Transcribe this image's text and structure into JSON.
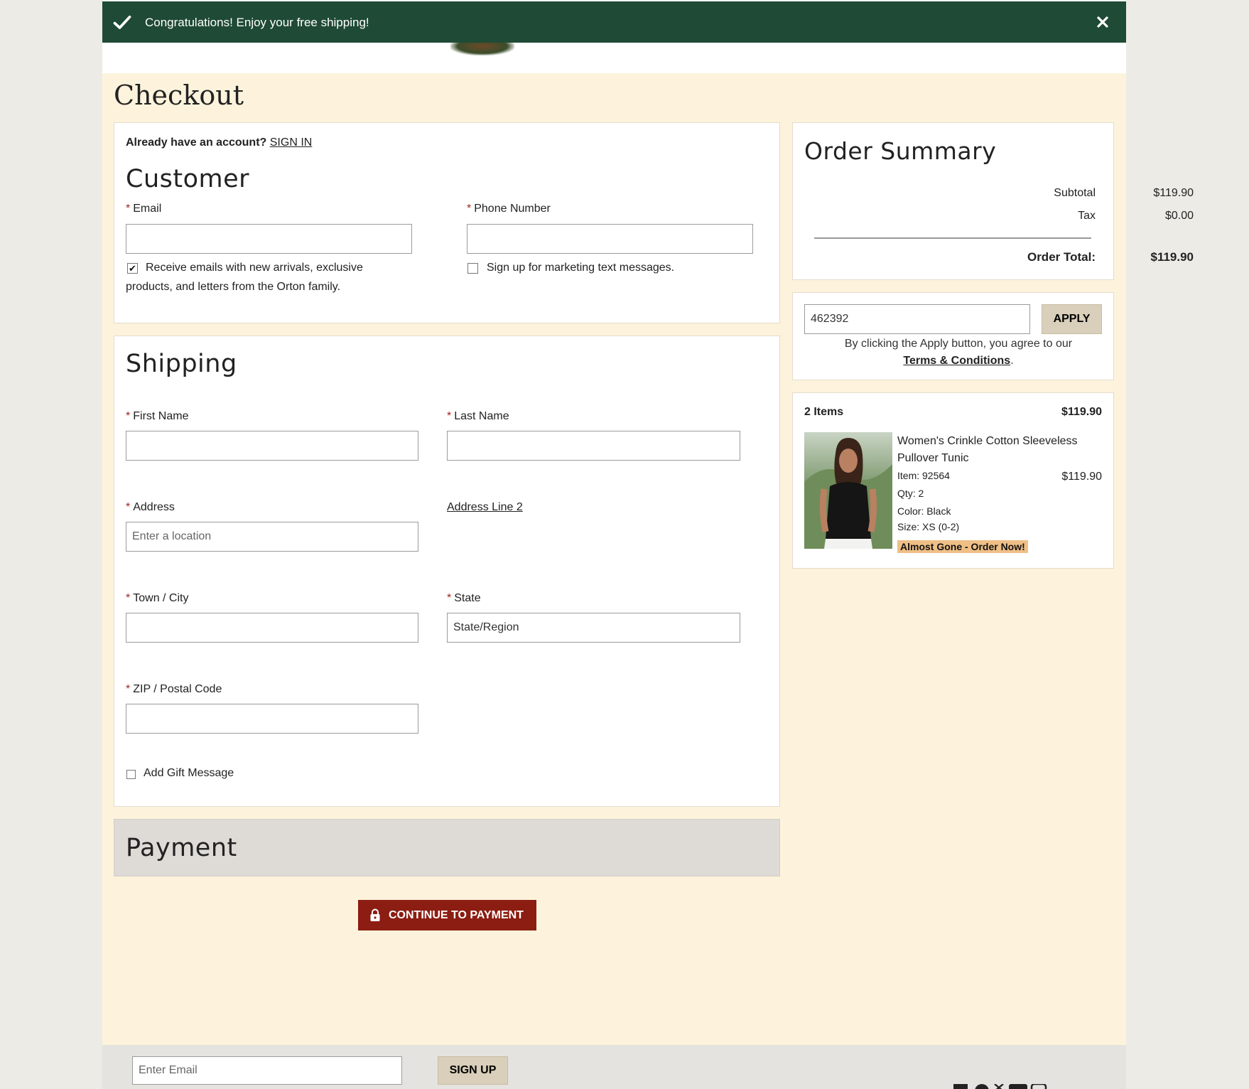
{
  "banner": {
    "message": "Congratulations! Enjoy your free shipping!"
  },
  "page": {
    "title": "Checkout"
  },
  "account": {
    "prompt": "Already have an account?",
    "sign_in": "SIGN IN"
  },
  "customer": {
    "heading": "Customer",
    "email_label": "Email",
    "phone_label": "Phone Number",
    "email_value": "",
    "phone_value": "",
    "email_optin": "Receive emails with new arrivals, exclusive products, and letters from the Orton family.",
    "email_optin_checked": true,
    "sms_optin": "Sign up for marketing text messages.",
    "sms_optin_checked": false
  },
  "shipping": {
    "heading": "Shipping",
    "first_name_label": "First Name",
    "last_name_label": "Last Name",
    "address_label": "Address",
    "address_placeholder": "Enter a location",
    "address_line2": "Address Line 2",
    "city_label": "Town / City",
    "state_label": "State",
    "state_value": "State/Region",
    "zip_label": "ZIP / Postal Code",
    "gift_message": "Add Gift Message"
  },
  "payment": {
    "heading": "Payment",
    "continue": "CONTINUE TO PAYMENT"
  },
  "summary": {
    "heading": "Order Summary",
    "subtotal_label": "Subtotal",
    "subtotal": "$119.90",
    "tax_label": "Tax",
    "tax": "$0.00",
    "total_label": "Order Total:",
    "total": "$119.90"
  },
  "promo": {
    "value": "462392",
    "apply": "APPLY",
    "note": "By clicking the Apply button, you agree to our",
    "terms": "Terms & Conditions",
    "period": "."
  },
  "cart": {
    "count": "2 Items",
    "total": "$119.90",
    "item": {
      "name_line1": "Women's Crinkle Cotton Sleeveless",
      "name_line2": "Pullover Tunic",
      "item_no": "Item: 92564",
      "price": "$119.90",
      "qty": "Qty: 2",
      "color": "Color: Black",
      "size": "Size: XS (0-2)",
      "badge": "Almost Gone - Order Now!"
    }
  },
  "footer": {
    "email_placeholder": "Enter Email",
    "signup": "SIGN UP"
  },
  "colors": {
    "banner": "#1f4a35",
    "accent": "#8c1d12",
    "page_bg": "#fdf3dc"
  }
}
